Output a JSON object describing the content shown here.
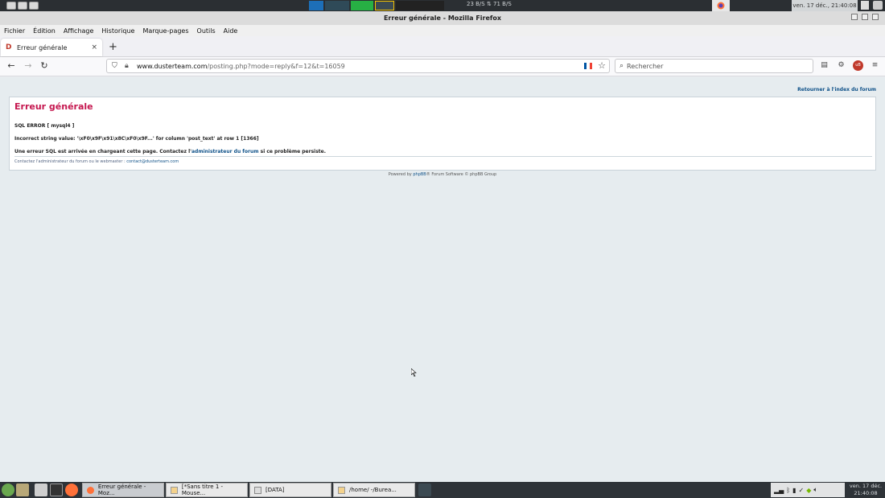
{
  "system_top": {
    "net_speed": "23 B/S ⇅ 71 B/S",
    "clock": "ven. 17 déc., 21:40:08"
  },
  "window": {
    "title": "Erreur générale - Mozilla Firefox"
  },
  "menu": [
    "Fichier",
    "Édition",
    "Affichage",
    "Historique",
    "Marque-pages",
    "Outils",
    "Aide"
  ],
  "tab": {
    "title": "Erreur générale",
    "close": "×",
    "new_tab": "+"
  },
  "nav": {
    "url_domain": "www.dusterteam.com",
    "url_path": "/posting.php?mode=reply&f=12&t=16059",
    "search_placeholder": "Rechercher"
  },
  "page": {
    "return_link": "Retourner à l'index du forum",
    "heading": "Erreur générale",
    "sql_error": "SQL ERROR [ mysql4 ]",
    "error_detail": "Incorrect string value: '\\xF0\\x9F\\x91\\x8C\\xF0\\x9F...' for column 'post_text' at row 1 [1366]",
    "message_before": "Une erreur SQL est arrivée en chargeant cette page. Contactez l'",
    "message_link": "administrateur du forum",
    "message_after": " si ce problème persiste.",
    "footer_text": "Contactez l'administrateur du forum ou le webmaster : ",
    "footer_email": "contact@dusterteam.com",
    "powered_before": "Powered by ",
    "powered_link": "phpBB",
    "powered_after": "® Forum Software © phpBB Group"
  },
  "taskbar": {
    "items": [
      {
        "label": "Erreur générale - Moz...",
        "icon": "firefox-icon"
      },
      {
        "label": "[*Sans titre 1 - Mouse...",
        "icon": "editor-icon"
      },
      {
        "label": "[DATA]",
        "icon": "folder-icon"
      },
      {
        "label": "/home/          -/Burea...",
        "icon": "editor-icon"
      }
    ],
    "clock_line1": "ven. 17 déc.",
    "clock_line2": "21:40:08"
  },
  "colors": {
    "heading": "#c5174f",
    "link": "#105289",
    "page_bg": "#e6ecef"
  }
}
